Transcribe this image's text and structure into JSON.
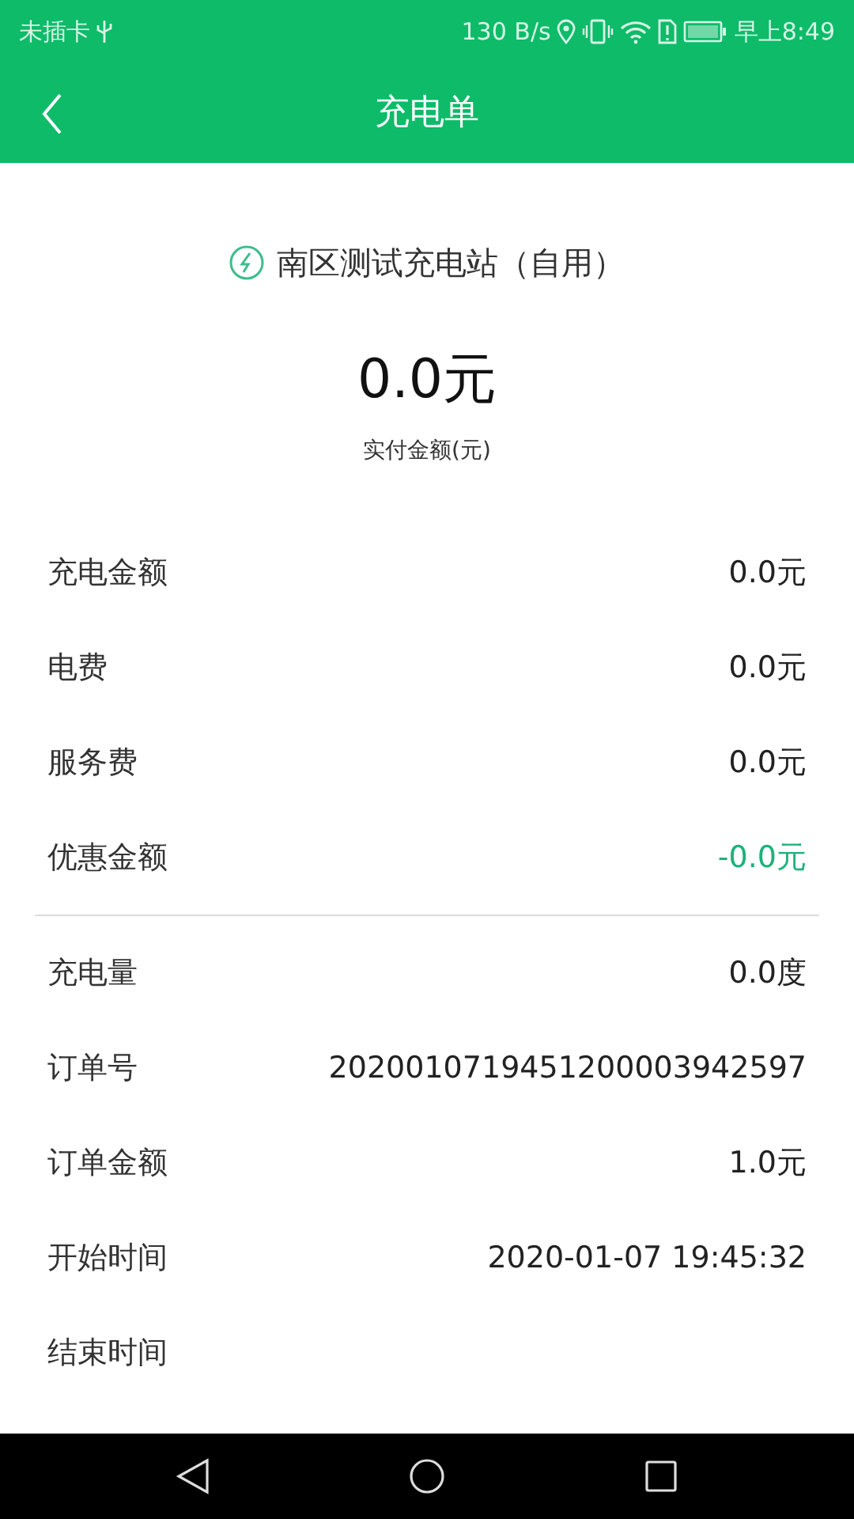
{
  "status_bar": {
    "carrier": "未插卡",
    "speed": "130 B/s",
    "time": "早上8:49"
  },
  "header": {
    "title": "充电单"
  },
  "station": {
    "name": "南区测试充电站（自用）"
  },
  "payment": {
    "amount": "0.0元",
    "label": "实付金额(元)"
  },
  "fee_items": [
    {
      "label": "充电金额",
      "value": "0.0元",
      "kind": "plain"
    },
    {
      "label": "电费",
      "value": "0.0元",
      "kind": "plain"
    },
    {
      "label": "服务费",
      "value": "0.0元",
      "kind": "plain"
    },
    {
      "label": "优惠金额",
      "value": "-0.0元",
      "kind": "discount"
    }
  ],
  "order_items": [
    {
      "label": "充电量",
      "value": "0.0度",
      "kind": "plain"
    },
    {
      "label": "订单号",
      "value": "2020010719451200003942597",
      "kind": "plain"
    },
    {
      "label": "订单金额",
      "value": "1.0元",
      "kind": "plain"
    },
    {
      "label": "开始时间",
      "value": "2020-01-07 19:45:32",
      "kind": "plain"
    },
    {
      "label": "结束时间"
    }
  ]
}
